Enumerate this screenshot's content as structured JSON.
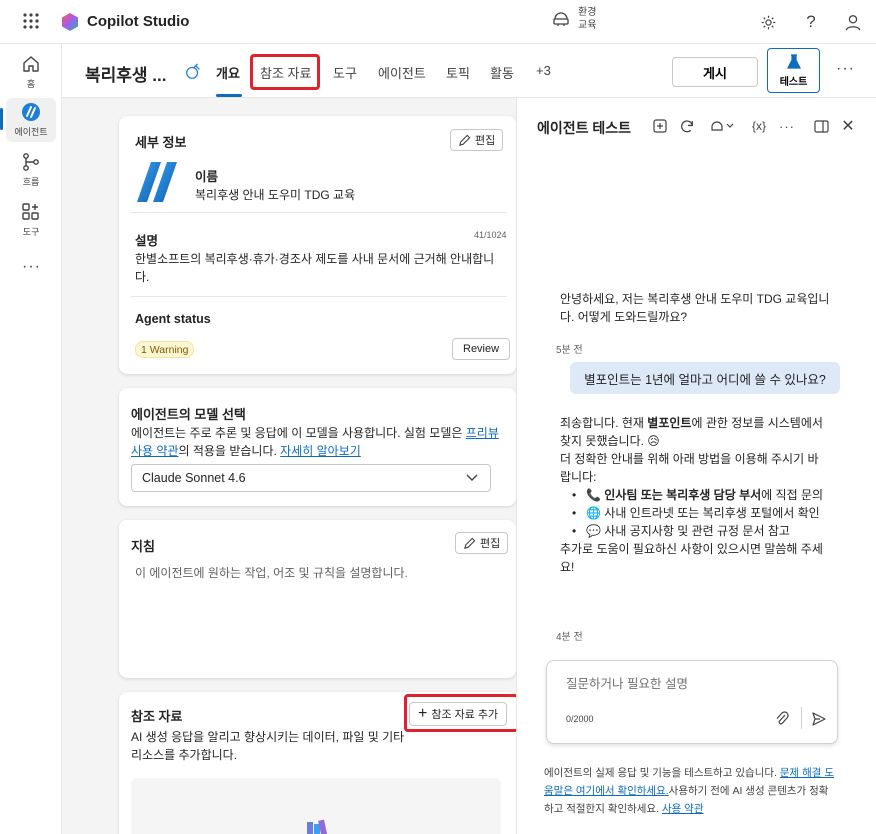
{
  "app": {
    "title": "Copilot Studio"
  },
  "env": {
    "line1": "환경",
    "line2": "교육"
  },
  "rail": [
    {
      "label": "홈"
    },
    {
      "label": "에이전트"
    },
    {
      "label": "흐름"
    },
    {
      "label": "도구"
    }
  ],
  "header": {
    "agent_name": "복리후생 ...",
    "tabs": [
      "개요",
      "참조 자료",
      "도구",
      "에이전트",
      "토픽",
      "활동",
      "+3"
    ],
    "publish": "게시",
    "test": "테스트"
  },
  "details": {
    "title": "세부 정보",
    "edit": "편집",
    "name_label": "이름",
    "name_value": "복리후생 안내 도우미 TDG 교육",
    "desc_label": "설명",
    "desc_count": "41/1024",
    "desc_value": "한별소프트의 복리후생·휴가·경조사 제도를 사내 문서에 근거해 안내합니다.",
    "status_label": "Agent status",
    "warning": "1 Warning",
    "review": "Review"
  },
  "model": {
    "title": "에이전트의 모델 선택",
    "desc_1": "에이전트는 주로 추론 및 응답에 이 모델을 사용합니다. 실험 모델은 ",
    "link_1": "프리뷰 사용 약관",
    "desc_2": "의 적용을 받습니다. ",
    "link_2": "자세히 알아보기",
    "selected": "Claude Sonnet 4.6"
  },
  "instructions": {
    "title": "지침",
    "edit": "편집",
    "placeholder": "이 에이전트에 원하는 작업, 어조 및 규칙을 설명합니다."
  },
  "knowledge": {
    "title": "참조 자료",
    "add": "참조 자료 추가",
    "desc": "AI 생성 응답을 알리고 향상시키는 데이터, 파일 및 기타 리소스를 추가합니다."
  },
  "test_pane": {
    "title": "에이전트 테스트",
    "variable_icon": "{x}",
    "greeting": "안녕하세요, 저는 복리후생 안내 도우미 TDG 교육입니다. 어떻게 도와드릴까요?",
    "ts1": "5분 전",
    "user_msg": "별포인트는 1년에 얼마고 어디에 쓸 수 있나요?",
    "reply_1a": "죄송합니다. 현재 ",
    "reply_1b": "별포인트",
    "reply_1c": "에 관한 정보를 시스템에서 찾지 못했습니다.",
    "reply_emoji": "😥",
    "reply_2": "더 정확한 안내를 위해 아래 방법을 이용해 주시기 바랍니다:",
    "opt1_icon": "📞",
    "opt1_bold": "인사팀 또는 복리후생 담당 부서",
    "opt1_rest": "에 직접 문의",
    "opt2_icon": "🌐",
    "opt2": "사내 인트라넷 또는 복리후생 포털에서 확인",
    "opt3_icon": "💬",
    "opt3": "사내 공지사항 및 관련 규정 문서 참고",
    "reply_3": "추가로 도움이 필요하신 사항이 있으시면 말씀해 주세요!",
    "ts2": "4분 전",
    "input_placeholder": "질문하거나 필요한 설명",
    "counter": "0/2000",
    "foot_1": "에이전트의 실제 응답 및 기능을 테스트하고 있습니다. ",
    "foot_link_1": "문제 해결 도움말은 여기에서 확인하세요.",
    "foot_2": "사용하기 전에 AI 생성 콘텐츠가 정확하고 적절한지 확인하세요. ",
    "foot_link_2": "사용 약관"
  },
  "colors": {
    "accent": "#0f6cbd",
    "highlight": "#e0232a",
    "warning_bg": "#fdf6d3"
  }
}
